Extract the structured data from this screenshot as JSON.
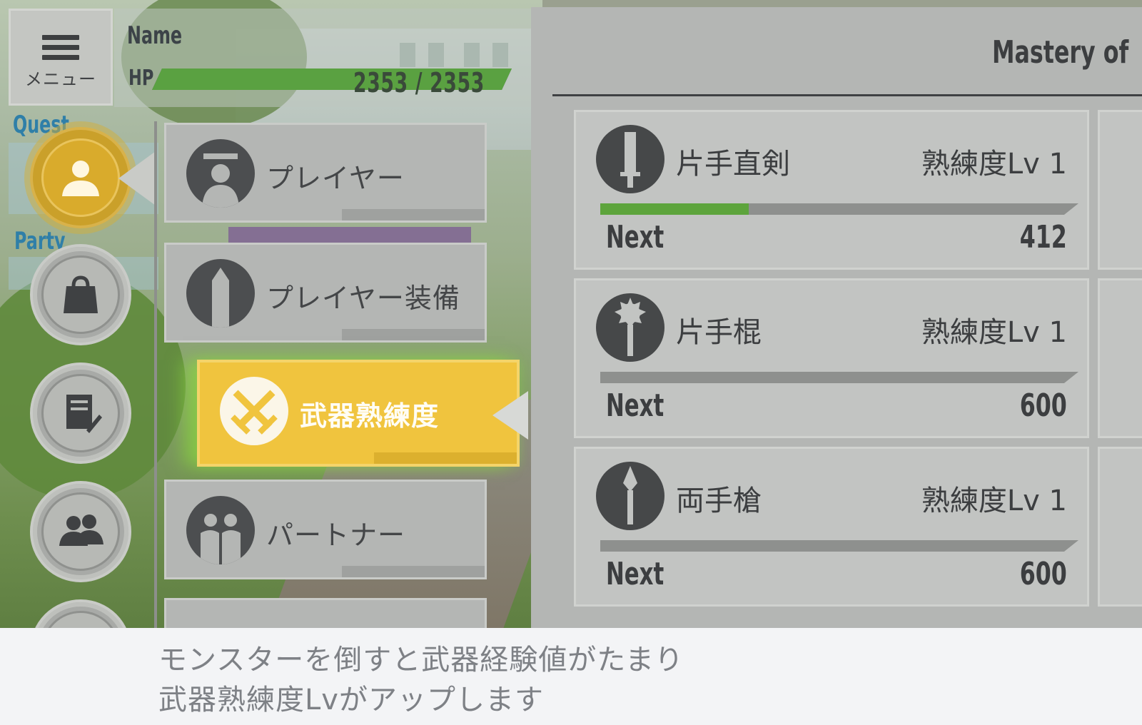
{
  "hud": {
    "menu_label": "メニュー",
    "name_label": "Name",
    "hp_label": "HP",
    "hp_value": "2353 / 2353",
    "hp_fraction": 1.0,
    "quest_label": "Quest",
    "party_label": "Party"
  },
  "side_icons": [
    {
      "name": "player-icon",
      "active": true
    },
    {
      "name": "bag-icon",
      "active": false
    },
    {
      "name": "notes-icon",
      "active": false
    },
    {
      "name": "friends-icon",
      "active": false
    }
  ],
  "menu": {
    "items": [
      {
        "label": "プレイヤー",
        "icon": "player-silhouette-icon"
      },
      {
        "label": "プレイヤー装備",
        "icon": "equipment-icon"
      },
      {
        "label": "武器熟練度",
        "icon": "crossed-swords-icon",
        "selected": true
      },
      {
        "label": "パートナー",
        "icon": "partner-icon"
      }
    ]
  },
  "mastery": {
    "title": "Mastery of",
    "weapons": [
      {
        "name": "片手直剣",
        "level": "熟練度Lv 1",
        "next_label": "Next",
        "next_value": "412",
        "progress": 0.31,
        "icon": "sword-icon"
      },
      {
        "name": "片手棍",
        "level": "熟練度Lv 1",
        "next_label": "Next",
        "next_value": "600",
        "progress": 0.0,
        "icon": "mace-icon"
      },
      {
        "name": "両手槍",
        "level": "熟練度Lv 1",
        "next_label": "Next",
        "next_value": "600",
        "progress": 0.0,
        "icon": "spear-icon"
      }
    ]
  },
  "message": {
    "line1": "モンスターを倒すと武器経験値がたまり",
    "line2": "武器熟練度Lvがアップします"
  },
  "colors": {
    "accent": "#f0c43e",
    "xp_green": "#5da43c",
    "hp_green": "#5aa141"
  }
}
